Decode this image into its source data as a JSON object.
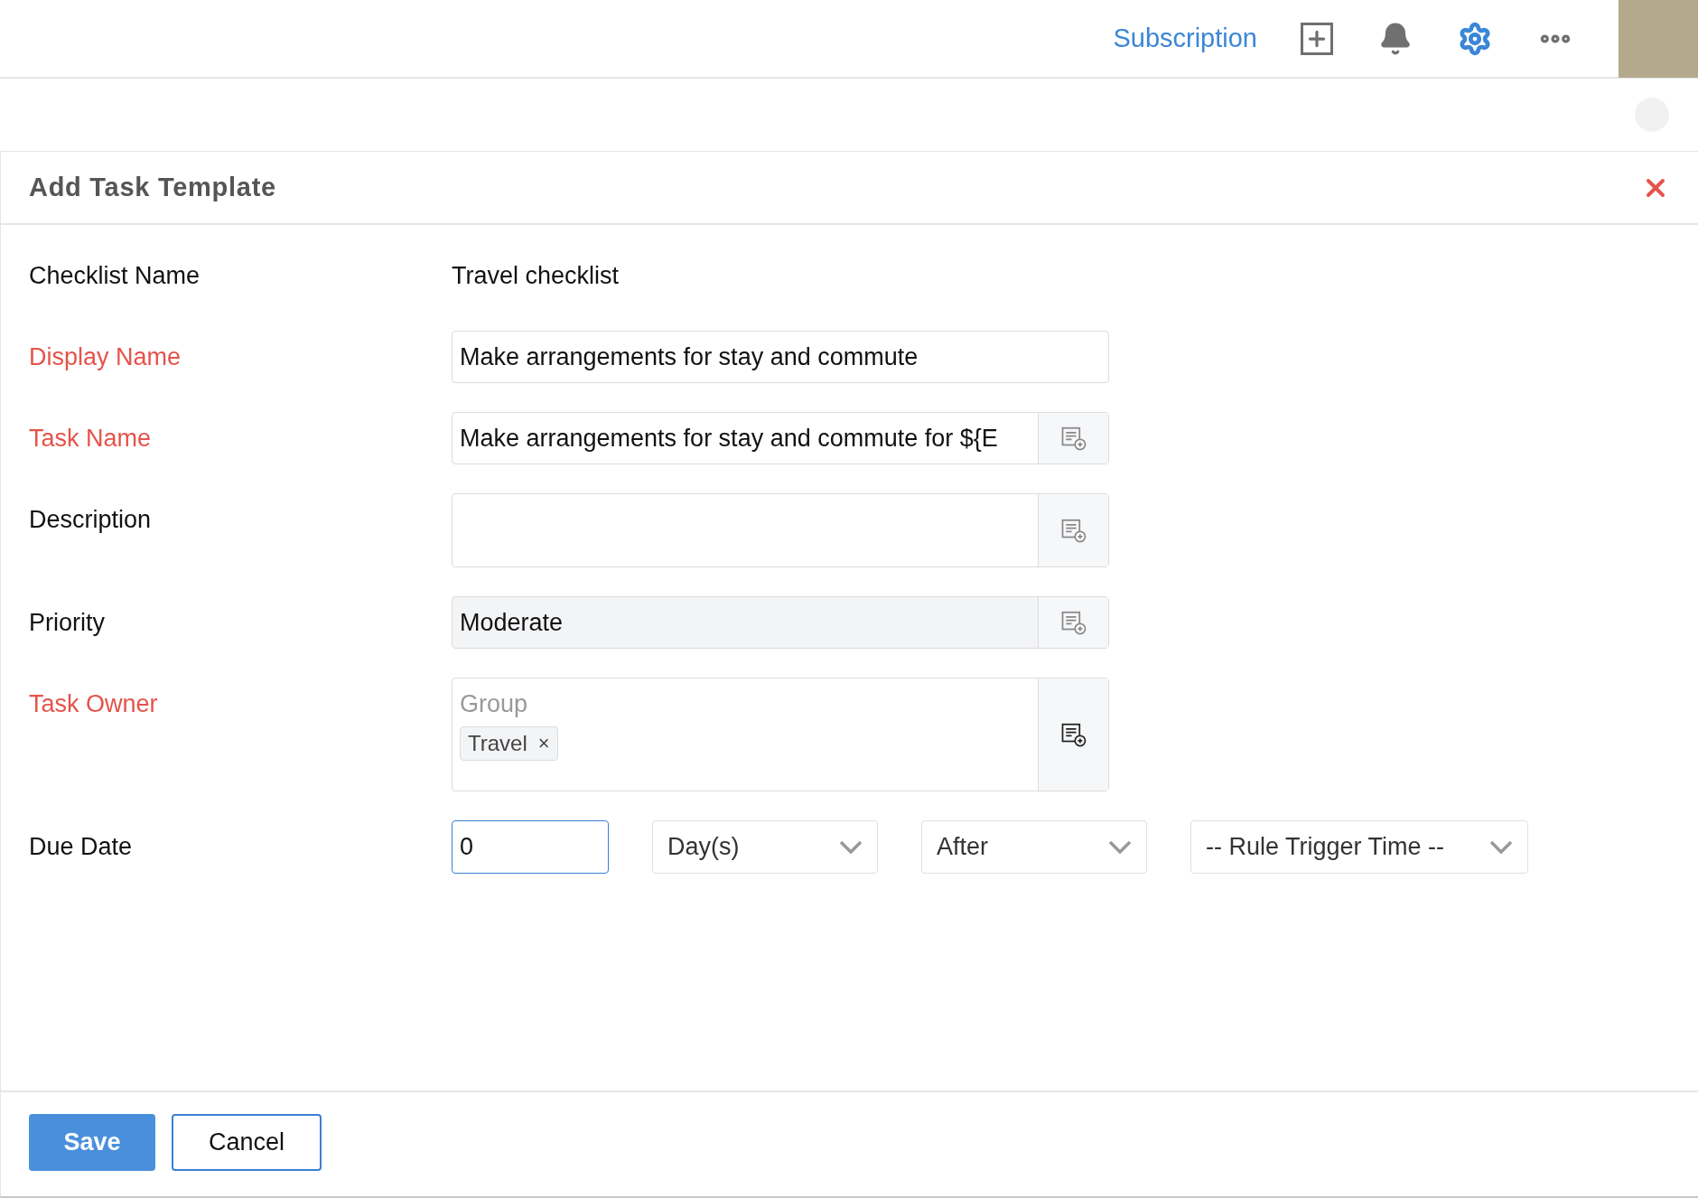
{
  "top_bar": {
    "link": "Subscription",
    "settings_active": true
  },
  "dialog": {
    "title": "Add Task Template",
    "rows": [
      {
        "kind": "text",
        "label": "Checklist Name",
        "required": false,
        "value": "Travel checklist"
      },
      {
        "kind": "input",
        "label": "Display Name",
        "required": true,
        "value": "Make arrangements for stay and commute"
      },
      {
        "kind": "input_addon",
        "label": "Task Name",
        "required": true,
        "value": "Make arrangements for stay and commute for ${E"
      },
      {
        "kind": "textarea_addon",
        "label": "Description",
        "required": false
      },
      {
        "kind": "readonly_addon",
        "label": "Priority",
        "required": false,
        "value": "Moderate"
      },
      {
        "kind": "tags",
        "label": "Task Owner",
        "required": true,
        "caption": "Group",
        "tags": [
          "Travel"
        ],
        "tag_remove": "×"
      },
      {
        "kind": "due",
        "label": "Due Date",
        "required": false,
        "value": "0",
        "focused": true,
        "selects": [
          "Day(s)",
          "After",
          "-- Rule Trigger Time --"
        ]
      }
    ],
    "buttons": [
      {
        "label": "Save",
        "primary": true
      },
      {
        "label": "Cancel",
        "primary": false
      }
    ]
  }
}
